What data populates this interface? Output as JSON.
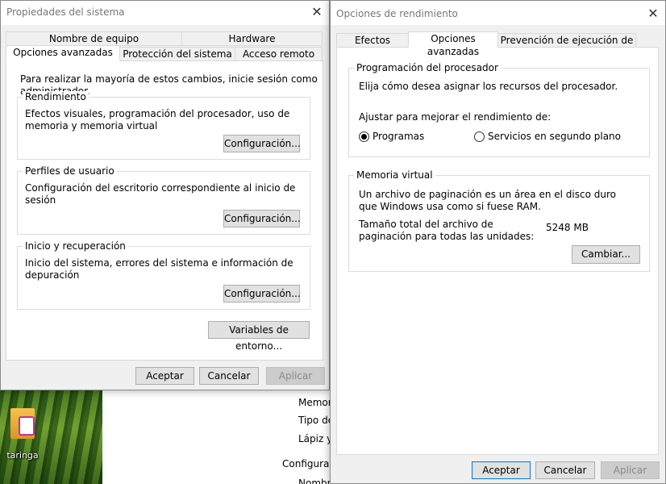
{
  "desktop": {
    "icon_label": "taringa",
    "under_window_lines": [
      "Memor",
      "Tipo de",
      "Lápiz y",
      "Configurac",
      "Nombr"
    ]
  },
  "system_properties": {
    "title": "Propiedades del sistema",
    "tabs_row1": [
      "Nombre de equipo",
      "Hardware"
    ],
    "tabs_row2": [
      "Opciones avanzadas",
      "Protección del sistema",
      "Acceso remoto"
    ],
    "active_tab": "Opciones avanzadas",
    "admin_note": "Para realizar la mayoría de estos cambios, inicie sesión como administrador.",
    "performance": {
      "title": "Rendimiento",
      "description": "Efectos visuales, programación del procesador, uso de memoria y memoria virtual",
      "button": "Configuración..."
    },
    "user_profiles": {
      "title": "Perfiles de usuario",
      "description": "Configuración del escritorio correspondiente al inicio de sesión",
      "button": "Configuración..."
    },
    "startup_recovery": {
      "title": "Inicio y recuperación",
      "description": "Inicio del sistema, errores del sistema e información de depuración",
      "button": "Configuración..."
    },
    "env_vars_button": "Variables de entorno...",
    "ok_button": "Aceptar",
    "cancel_button": "Cancelar",
    "apply_button": "Aplicar"
  },
  "performance_options": {
    "title": "Opciones de rendimiento",
    "tabs": [
      "Efectos visuales",
      "Opciones avanzadas",
      "Prevención de ejecución de datos"
    ],
    "active_tab": "Opciones avanzadas",
    "processor": {
      "title": "Programación del procesador",
      "description": "Elija cómo desea asignar los recursos del procesador.",
      "adjust_label": "Ajustar para mejorar el rendimiento de:",
      "option_programs": "Programas",
      "option_services": "Servicios en segundo plano",
      "selected": "Programas"
    },
    "virtual_memory": {
      "title": "Memoria virtual",
      "description": "Un archivo de paginación es un área en el disco duro que Windows usa como si fuese RAM.",
      "total_label": "Tamaño total del archivo de paginación para todas las unidades:",
      "total_value": "5248 MB",
      "change_button": "Cambiar..."
    },
    "ok_button": "Aceptar",
    "cancel_button": "Cancelar",
    "apply_button": "Aplicar"
  }
}
